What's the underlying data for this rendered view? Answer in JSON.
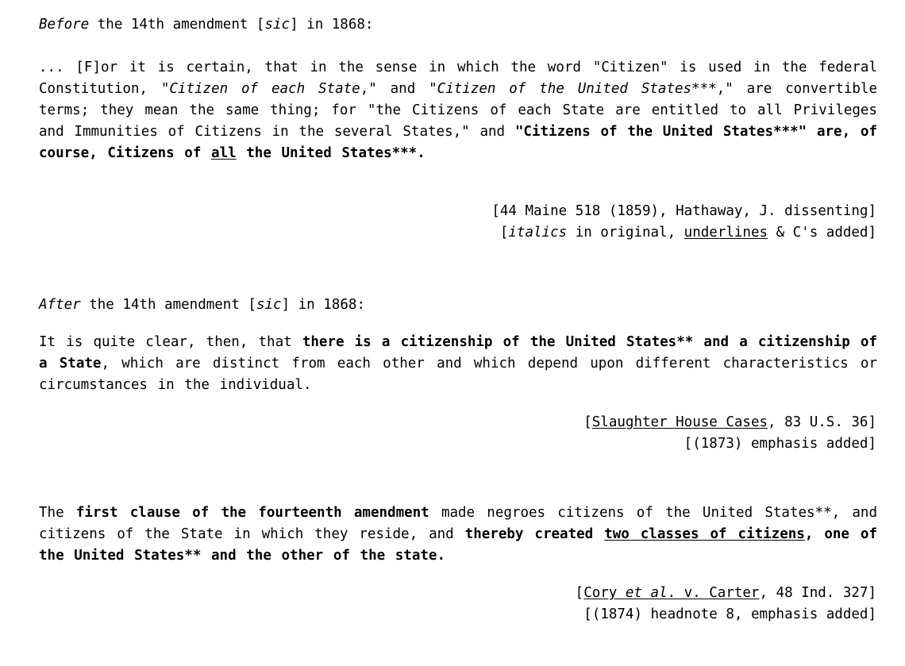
{
  "document": {
    "section_before": {
      "heading": {
        "emph": "Before",
        "rest": " the 14th amendment [",
        "sic": "sic",
        "tail": "] in 1868:"
      },
      "quote": {
        "run1": "... [F]or it is certain, that in the sense in which the word \"Citizen\" is used in the federal Constitution, \"",
        "run2_italic": "Citizen of each State",
        "run3": ",\" and \"",
        "run4_italic": "Citizen of the United States***",
        "run5": ",\" are convertible terms;  they mean the same thing;  for \"the Citizens of each State are entitled to all Privileges and Immunities of Citizens in the several States,\" and ",
        "run6_bold": "\"Citizens of the United States***\" are, of course, Citizens of ",
        "run7_bold_underline": "all",
        "run8_bold": " the United States***."
      },
      "citation": {
        "line1": "[44 Maine 518 (1859), Hathaway, J. dissenting]",
        "line2_open": "[",
        "line2_italic": "italics",
        "line2_mid": " in original, ",
        "line2_underline": "underlines",
        "line2_close": " & C's added]"
      }
    },
    "section_after": {
      "heading": {
        "emph": "After",
        "rest": " the 14th amendment [",
        "sic": "sic",
        "tail": "] in 1868:"
      },
      "quote": {
        "run1": "It is quite clear, then, that ",
        "run2_bold": "there is a citizenship of the United States** and a citizenship of a State",
        "run3": ", which are distinct from each other and which depend upon different characteristics or circumstances in the individual."
      },
      "citation": {
        "line1_open": "[",
        "line1_underline": "Slaughter House Cases",
        "line1_close": ", 83 U.S. 36]",
        "line2": "[(1873) emphasis added]"
      }
    },
    "section_cory": {
      "quote": {
        "run1": "The ",
        "run2_bold": "first clause of the fourteenth amendment",
        "run3": " made negroes citizens of the United States**, and citizens of the State in which they reside, and ",
        "run4_bold": "thereby created ",
        "run5_bold_underline": "two classes of citizens",
        "run6_bold": ", one of the United States** and the other of the state."
      },
      "citation": {
        "line1_open": "[",
        "line1_underline_a": "Cory ",
        "line1_underline_italic": "et al",
        "line1_underline_b": ". v. Carter",
        "line1_close": ", 48 Ind. 327]",
        "line2": "[(1874) headnote 8, emphasis added]"
      }
    }
  },
  "theme": {
    "background": "#ffffff",
    "text_color": "#000000"
  }
}
